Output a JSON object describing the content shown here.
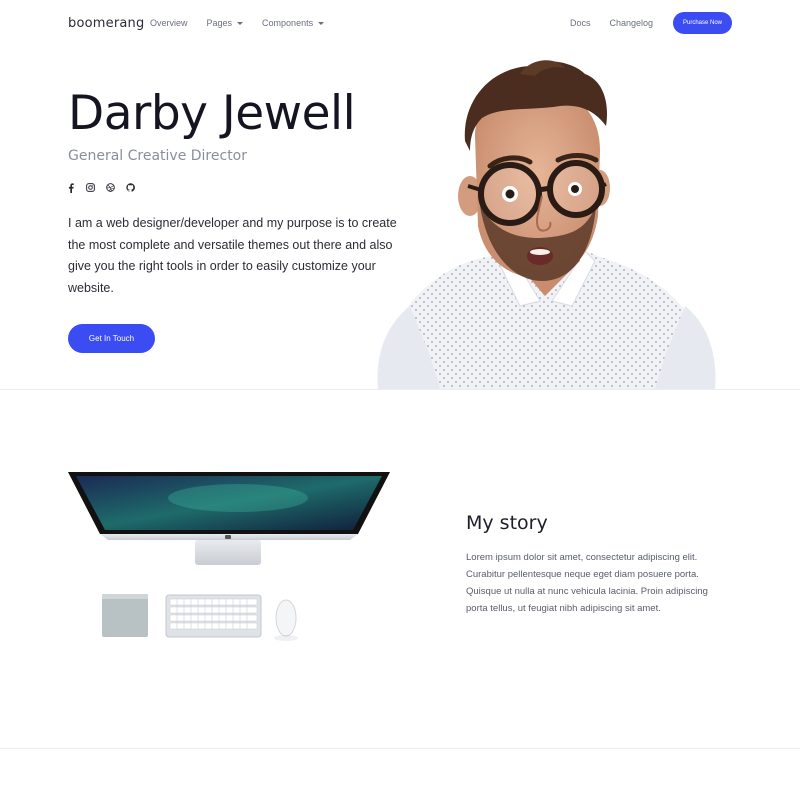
{
  "nav": {
    "brand": "boomerang",
    "left_links": [
      "Overview",
      "Pages",
      "Components"
    ],
    "right_links": [
      "Docs",
      "Changelog"
    ],
    "cta": "Purchase Now"
  },
  "hero": {
    "name": "Darby Jewell",
    "role": "General Creative Director",
    "socials": [
      "facebook-icon",
      "instagram-icon",
      "dribbble-icon",
      "github-icon"
    ],
    "bio": "I am a web designer/developer and my purpose is to create the most complete and versatile themes out there and also give you the right tools in order to easily customize your website.",
    "button": "Get In Touch"
  },
  "story": {
    "title": "My story",
    "text": "Lorem ipsum dolor sit amet, consectetur adipiscing elit. Curabitur pellentesque neque eget diam posuere porta. Quisque ut nulla at nunc vehicula lacinia. Proin adipiscing porta tellus, ut feugiat nibh adipiscing sit amet."
  },
  "colors": {
    "accent": "#3b4cf3",
    "text": "#1e1e2f",
    "muted": "#8a8f99"
  }
}
